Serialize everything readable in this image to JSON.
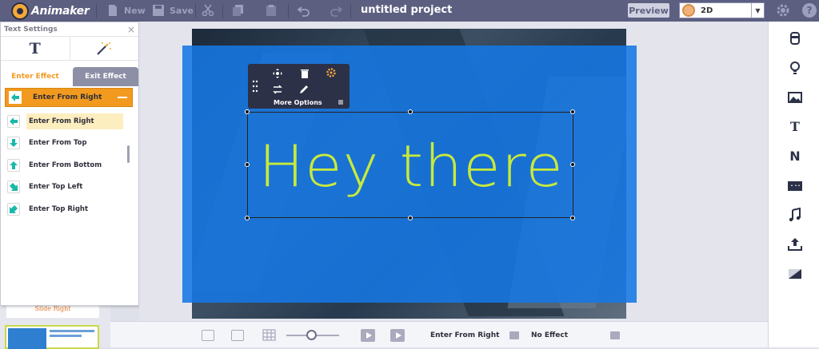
{
  "topbar": {
    "app_name": "Animaker",
    "new_label": "New",
    "save_label": "Save",
    "project_title": "untitled project",
    "preview_label": "Preview",
    "mode_value": "2D",
    "help_label": "?"
  },
  "panel": {
    "title": "Text Settings",
    "close_glyph": "×",
    "text_glyph": "T",
    "tab_enter": "Enter Effect",
    "tab_exit": "Exit Effect",
    "selected_effect": "Enter From Right",
    "effects": [
      {
        "label": "Enter From Right",
        "icon": "arrow-left-icon"
      },
      {
        "label": "Enter From Top",
        "icon": "arrow-down-icon"
      },
      {
        "label": "Enter From Bottom",
        "icon": "arrow-up-icon"
      },
      {
        "label": "Enter Top Left",
        "icon": "arrow-down-right-icon"
      },
      {
        "label": "Enter Top Right",
        "icon": "arrow-down-left-icon"
      }
    ]
  },
  "slides": {
    "partial_label": "Slide Right"
  },
  "canvas": {
    "text": "Hey there",
    "toolbar_label": "More Options"
  },
  "bottombar": {
    "enter_effect": "Enter From Right",
    "exit_effect": "No Effect"
  },
  "colors": {
    "topbar": "#5c5f80",
    "accent_orange": "#f29a1f",
    "blue_box": "#1678e4",
    "text_color": "#c7ea3c"
  }
}
